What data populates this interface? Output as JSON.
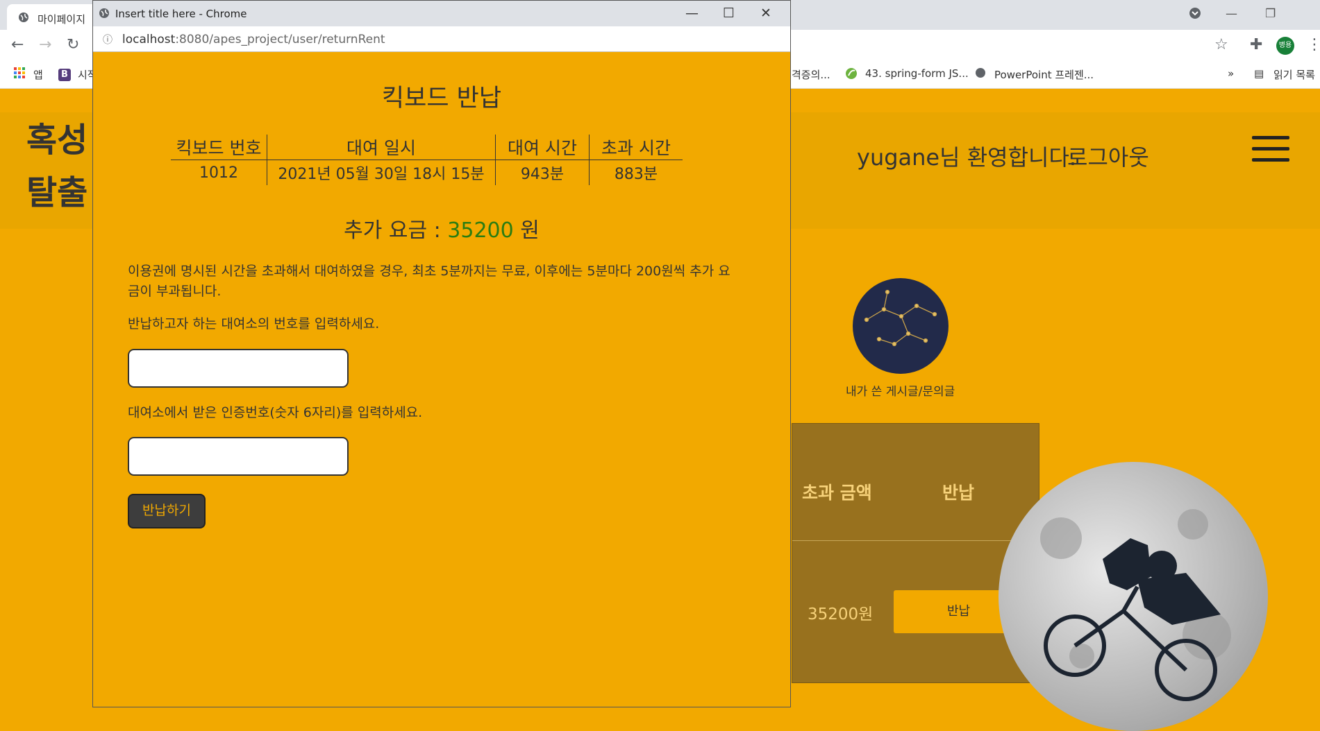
{
  "background_browser": {
    "tab_title": "마이페이지",
    "address_hint": "",
    "bookmarks": [
      "앱",
      "시작",
      "격증의...",
      "43. spring-form JS...",
      "PowerPoint 프레젠..."
    ],
    "bookmark_more": "»",
    "reading_list": "읽기 목록",
    "profile_initials": "병용",
    "win_min": "—",
    "win_max": "❐"
  },
  "site": {
    "logo_line1": "혹성",
    "logo_line2": "탈출",
    "welcome": "yugane님 환영합니다.",
    "logout": "로그아웃",
    "my_posts_label": "내가 쓴 게시글/문의글",
    "rent_table": {
      "headers": [
        "초과 금액",
        "반납"
      ],
      "fee": "35200원",
      "return_button": "반납"
    }
  },
  "popup": {
    "window_title": "Insert title here - Chrome",
    "url_host": "localhost",
    "url_path": ":8080/apes_project/user/returnRent",
    "heading": "킥보드 반납",
    "table": {
      "headers": [
        "킥보드 번호",
        "대여 일시",
        "대여 시간",
        "초과 시간"
      ],
      "row": [
        "1012",
        "2021년 05월 30일 18시 15분",
        "943분",
        "883분"
      ]
    },
    "fee_label": "추가 요금 :",
    "fee_amount": "35200",
    "fee_unit": "원",
    "notice": "이용권에 명시된 시간을 초과해서 대여하였을 경우, 최초 5분까지는 무료, 이후에는 5분마다 200원씩 추가 요금이 부과됩니다.",
    "station_prompt": "반납하고자 하는 대여소의 번호를 입력하세요.",
    "station_value": "",
    "auth_prompt": "대여소에서 받은 인증번호(숫자 6자리)를 입력하세요.",
    "auth_value": "",
    "submit_label": "반납하기"
  }
}
